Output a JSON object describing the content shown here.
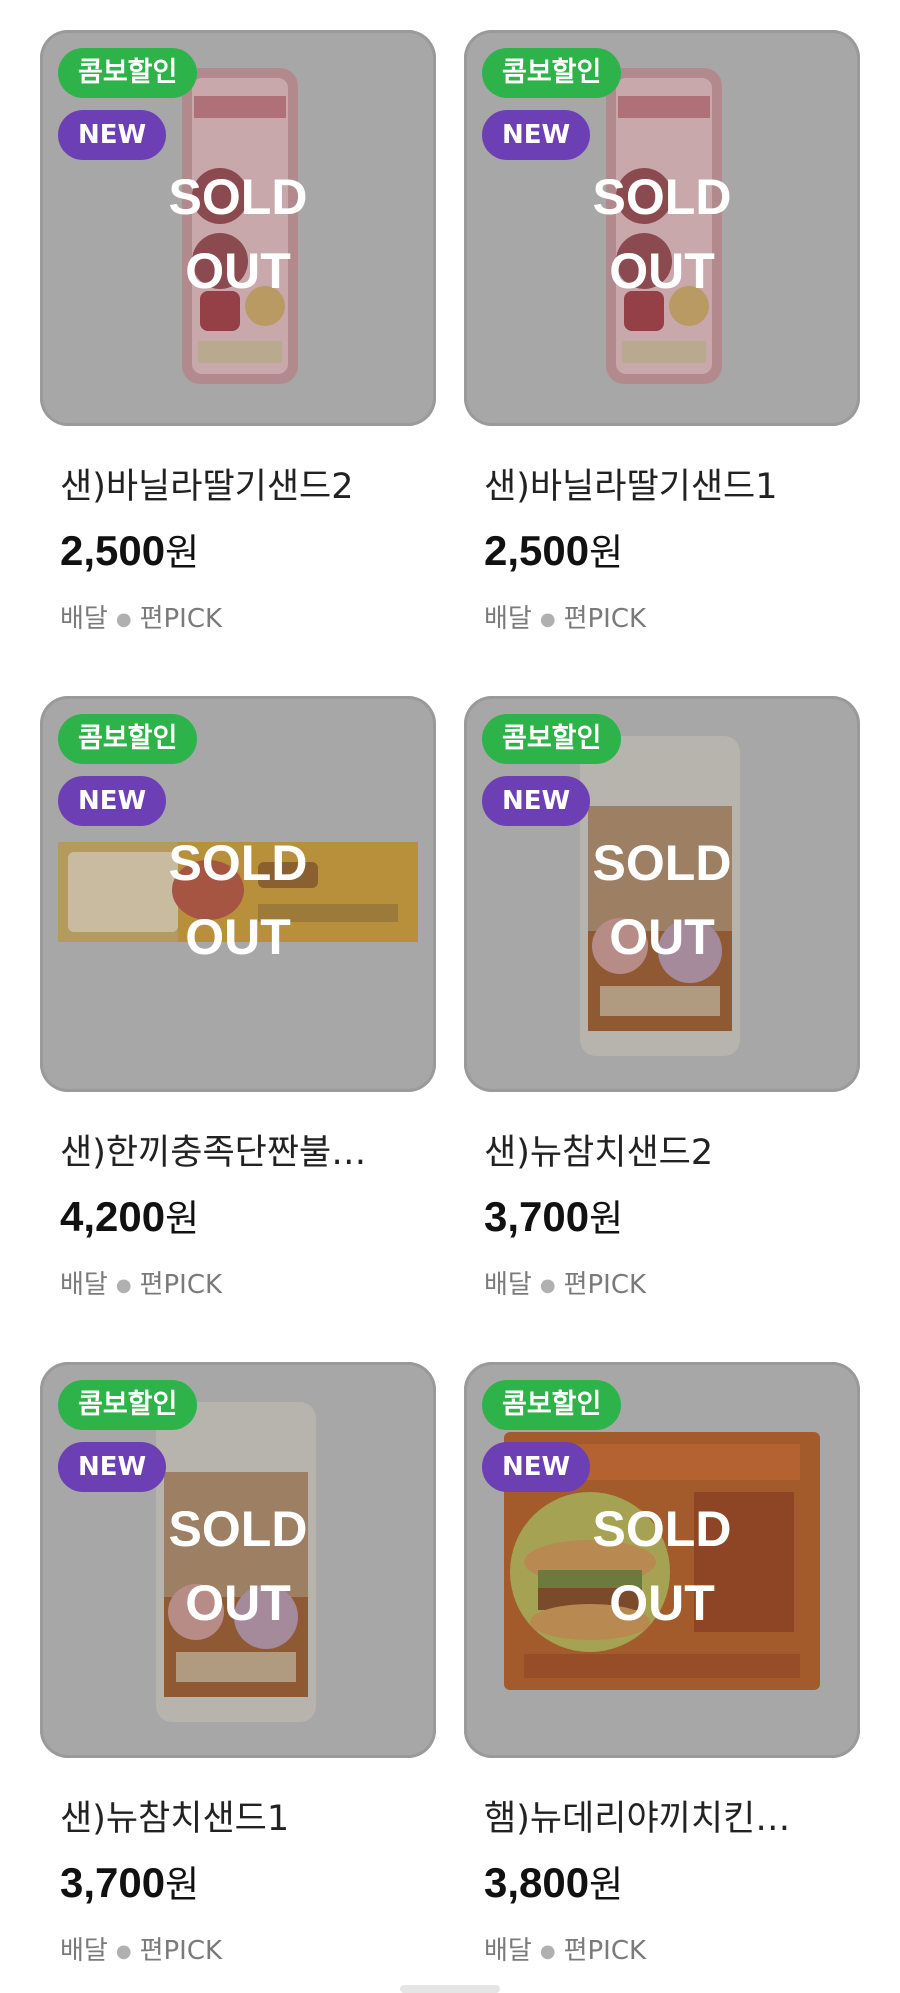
{
  "products": [
    {
      "combo_badge": "콤보할인",
      "new_badge": "NEW",
      "sold_out": "SOLD",
      "sold_out2": "OUT",
      "name": "샌)바닐라딸기샌드2",
      "price": "2,500",
      "currency": "원",
      "tag1": "배달",
      "tag2": "편PICK",
      "product_image": "strawberry-sandwich"
    },
    {
      "combo_badge": "콤보할인",
      "new_badge": "NEW",
      "sold_out": "SOLD",
      "sold_out2": "OUT",
      "name": "샌)바닐라딸기샌드1",
      "price": "2,500",
      "currency": "원",
      "tag1": "배달",
      "tag2": "편PICK",
      "product_image": "strawberry-sandwich"
    },
    {
      "combo_badge": "콤보할인",
      "new_badge": "NEW",
      "sold_out": "SOLD",
      "sold_out2": "OUT",
      "name": "샌)한끼충족단짠불…",
      "price": "4,200",
      "currency": "원",
      "tag1": "배달",
      "tag2": "편PICK",
      "product_image": "wrap"
    },
    {
      "combo_badge": "콤보할인",
      "new_badge": "NEW",
      "sold_out": "SOLD",
      "sold_out2": "OUT",
      "name": "샌)뉴참치샌드2",
      "price": "3,700",
      "currency": "원",
      "tag1": "배달",
      "tag2": "편PICK",
      "product_image": "fresh-sandwich"
    },
    {
      "combo_badge": "콤보할인",
      "new_badge": "NEW",
      "sold_out": "SOLD",
      "sold_out2": "OUT",
      "name": "샌)뉴참치샌드1",
      "price": "3,700",
      "currency": "원",
      "tag1": "배달",
      "tag2": "편PICK",
      "product_image": "fresh-sandwich"
    },
    {
      "combo_badge": "콤보할인",
      "new_badge": "NEW",
      "sold_out": "SOLD",
      "sold_out2": "OUT",
      "name": "햄)뉴데리야끼치킨…",
      "price": "3,800",
      "currency": "원",
      "tag1": "배달",
      "tag2": "편PICK",
      "product_image": "chicken-burger"
    }
  ],
  "colors": {
    "combo": "#2eb34b",
    "new": "#6c3fb5",
    "overlay": "#a7a7a7"
  }
}
